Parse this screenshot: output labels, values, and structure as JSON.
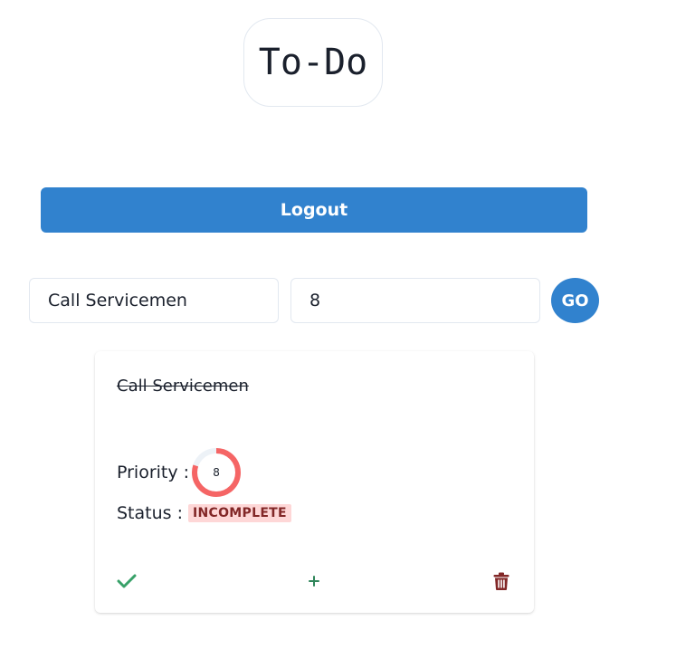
{
  "header": {
    "title": "To-Do"
  },
  "auth": {
    "logout_label": "Logout"
  },
  "form": {
    "task_value": "Call Servicemen",
    "priority_value": "8",
    "submit_label": "GO"
  },
  "todos": [
    {
      "name": "Call Servicemen",
      "completed": true,
      "priority_label": "Priority :",
      "priority": "8",
      "priority_fraction": 0.8,
      "priority_color": "#f56565",
      "status_label": "Status :",
      "status": "INCOMPLETE",
      "status_bg": "#fed7d7",
      "status_color": "#822727",
      "actions": {
        "done_icon": "check-icon",
        "add_icon": "plus-icon",
        "delete_icon": "trash-icon"
      }
    }
  ],
  "colors": {
    "accent": "#3182ce",
    "success": "#38a169",
    "danger": "#822727"
  }
}
